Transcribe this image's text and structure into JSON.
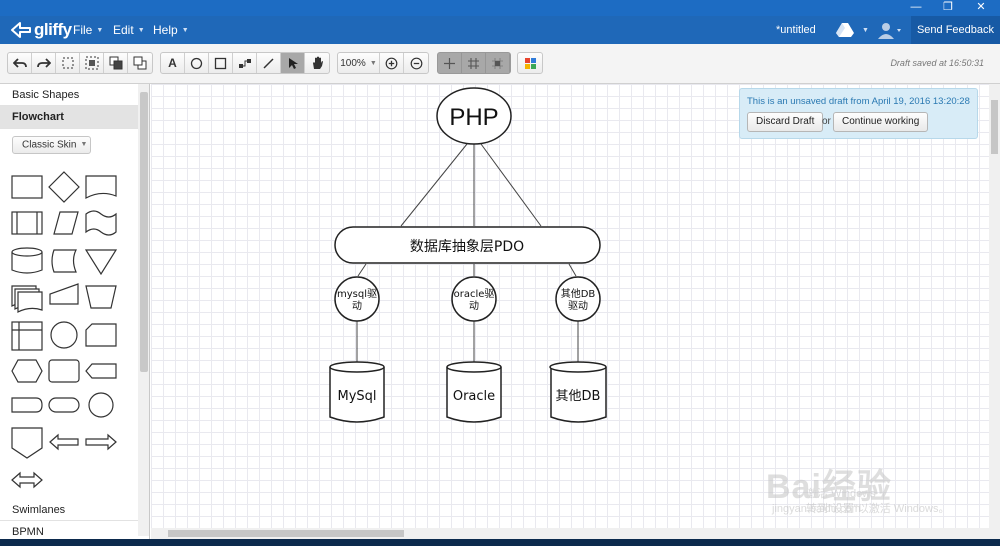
{
  "window": {
    "minimize": "—",
    "restore": "❐",
    "close": "✕"
  },
  "nav": {
    "logo": "gliffy",
    "menus": [
      "File",
      "Edit",
      "Help"
    ],
    "doc_title": "*untitled",
    "feedback": "Send Feedback"
  },
  "toolbar": {
    "zoom": "100%",
    "saved": "Draft saved at 16:50:31",
    "text_tool": "A"
  },
  "sidebar": {
    "sections": [
      "Basic Shapes",
      "Flowchart",
      "Swimlanes",
      "BPMN"
    ],
    "skin": "Classic Skin"
  },
  "notice": {
    "text": "This is an unsaved draft from April 19, 2016 13:20:28",
    "discard": "Discard Draft",
    "or": "or",
    "continue": "Continue working"
  },
  "diagram": {
    "php": "PHP",
    "pdo": "数据库抽象层PDO",
    "drivers": [
      {
        "line1": "mysql驱",
        "line2": "动"
      },
      {
        "line1": "oracle驱",
        "line2": "动"
      },
      {
        "line1": "其他DB",
        "line2": "驱动"
      }
    ],
    "databases": [
      "MySql",
      "Oracle",
      "其他DB"
    ]
  },
  "watermark": {
    "brand": "Bai经验",
    "site": "jingyan.baidu.com",
    "activate1": "激活 Windows",
    "activate2": "转到\"设置\"以激活 Windows。"
  },
  "colors": {
    "nav": "#1f68b8",
    "feedback": "#175aa5",
    "notice_bg": "#d8ecf7",
    "notice_text": "#2a79b2"
  }
}
